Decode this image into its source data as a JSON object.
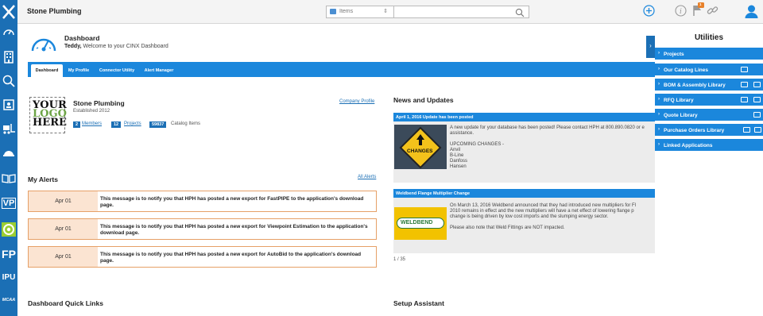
{
  "topbar": {
    "brand": "Stone Plumbing",
    "search_type": "Items",
    "search_type_arrows": "⇕",
    "search_placeholder": ""
  },
  "sidebar": {
    "vp_label": "VP",
    "fp_label": "FP",
    "ipu_label": "IPU",
    "mcaa_label": "MCAA"
  },
  "dashboard": {
    "title": "Dashboard",
    "user": "Teddy,",
    "welcome": " Welcome to your CINX Dashboard",
    "tabs": [
      "Dashboard",
      "My Profile",
      "Connector Utility",
      "Alert Manager"
    ]
  },
  "company": {
    "logo_lines": [
      "YOUR",
      "LOGO",
      "HERE"
    ],
    "name": "Stone Plumbing",
    "established": "Established 2012",
    "members_count": "2",
    "members_label": "Members",
    "projects_count": "12",
    "projects_label": "Projects",
    "catalog_count": "59837",
    "catalog_label": "Catalog Items",
    "profile_link": "Company Profile"
  },
  "alerts": {
    "title": "My Alerts",
    "all_link": "All Alerts",
    "items": [
      {
        "date": "Apr 01",
        "message": "This message is to notify you that HPH has posted a new export for FastPIPE to the application's download page."
      },
      {
        "date": "Apr 01",
        "message": "This message is to notify you that HPH has posted a new export for Viewpoint Estimation to the application's download page."
      },
      {
        "date": "Apr 01",
        "message": "This message is to notify you that HPH has posted a new export for AutoBid to the application's download page."
      }
    ]
  },
  "news": {
    "title": "News and Updates",
    "items": [
      {
        "headline": "April 1, 2016 Update has been posted",
        "text": "A new update for your database has been posted! Please contact HPH at 800.890.0820 or e\nassistance.\n\nUPCOMING CHANGES -\nAnvil\nB-Line\nDanfoss\nHansen",
        "image_text": "CHANGES"
      },
      {
        "headline": "Weldbend Flange Multiplier Change",
        "text": "On March 13, 2016 Weldbend announced that they had introduced new multipliers for Fl\n2010 remains in effect and the new multipliers will have a net effect of lowering flange p\nchange is being driven by low cost imports and the slumping energy sector.\n\nPlease also note that Weld Fittings are NOT impacted.",
        "image_text": "WELDBEND"
      }
    ],
    "pager": "1 / 35"
  },
  "quick_links": {
    "title": "Dashboard Quick Links"
  },
  "setup": {
    "title": "Setup Assistant"
  },
  "utilities": {
    "title": "Utilities",
    "items": [
      {
        "label": "Projects"
      },
      {
        "label": "Our Catalog Lines"
      },
      {
        "label": "BOM & Assembly Library"
      },
      {
        "label": "RFQ Library"
      },
      {
        "label": "Quote Library"
      },
      {
        "label": "Purchase Orders Library"
      },
      {
        "label": "Linked Applications"
      }
    ]
  },
  "notifications": {
    "count": "1"
  },
  "colors": {
    "primary": "#1b87dc",
    "sidebar": "#1b6fb5",
    "alert_border": "#e6a067",
    "alert_bg": "#fbe4d2"
  }
}
